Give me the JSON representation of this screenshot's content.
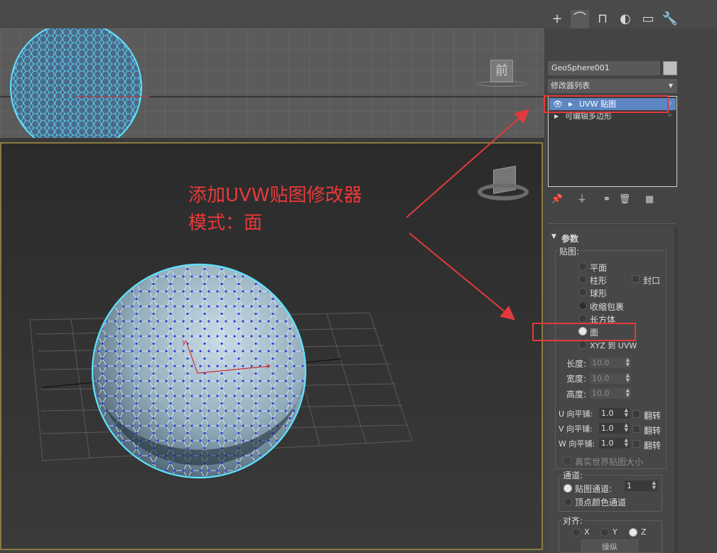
{
  "command_panel": {
    "tabs": [
      {
        "icon": "plus-icon",
        "glyph": "+"
      },
      {
        "icon": "modify-icon",
        "glyph": "⌒"
      },
      {
        "icon": "hierarchy-icon",
        "glyph": "⊓"
      },
      {
        "icon": "motion-icon",
        "glyph": "◐"
      },
      {
        "icon": "display-icon",
        "glyph": "▭"
      },
      {
        "icon": "utilities-icon",
        "glyph": "🔧"
      }
    ],
    "object_name": "GeoSphere001",
    "object_color": "#bdbdbd",
    "modifier_list_label": "修改器列表",
    "stack": [
      {
        "label": "UVW 贴图",
        "selected": true
      },
      {
        "label": "可编辑多边形",
        "selected": false
      }
    ]
  },
  "params": {
    "title": "参数",
    "mapping_group": "贴图:",
    "options": [
      "平面",
      "柱形",
      "球形",
      "收缩包裹",
      "长方体",
      "面",
      "XYZ 到 UVW"
    ],
    "selected_option": "面",
    "cap_label": "封口",
    "length_label": "长度:",
    "length_value": "10.0",
    "width_label": "宽度:",
    "width_value": "10.0",
    "height_label": "高度:",
    "height_value": "10.0",
    "u_tile_label": "U 向平铺:",
    "u_tile_value": "1.0",
    "v_tile_label": "V 向平铺:",
    "v_tile_value": "1.0",
    "w_tile_label": "W 向平铺:",
    "w_tile_value": "1.0",
    "flip_label": "翻转",
    "real_world_label": "真实世界贴图大小",
    "channel_group": "通道:",
    "map_channel_label": "贴图通道:",
    "map_channel_value": "1",
    "vertex_color_label": "顶点颜色通道",
    "align_group": "对齐:",
    "align_x": "X",
    "align_y": "Y",
    "align_z": "Z",
    "fit_label": "操纵"
  },
  "viewport": {
    "front_cube_label": "前"
  },
  "annotation": {
    "line1": "添加UVW贴图修改器",
    "line2": "模式：面",
    "color": "#e8393a"
  }
}
